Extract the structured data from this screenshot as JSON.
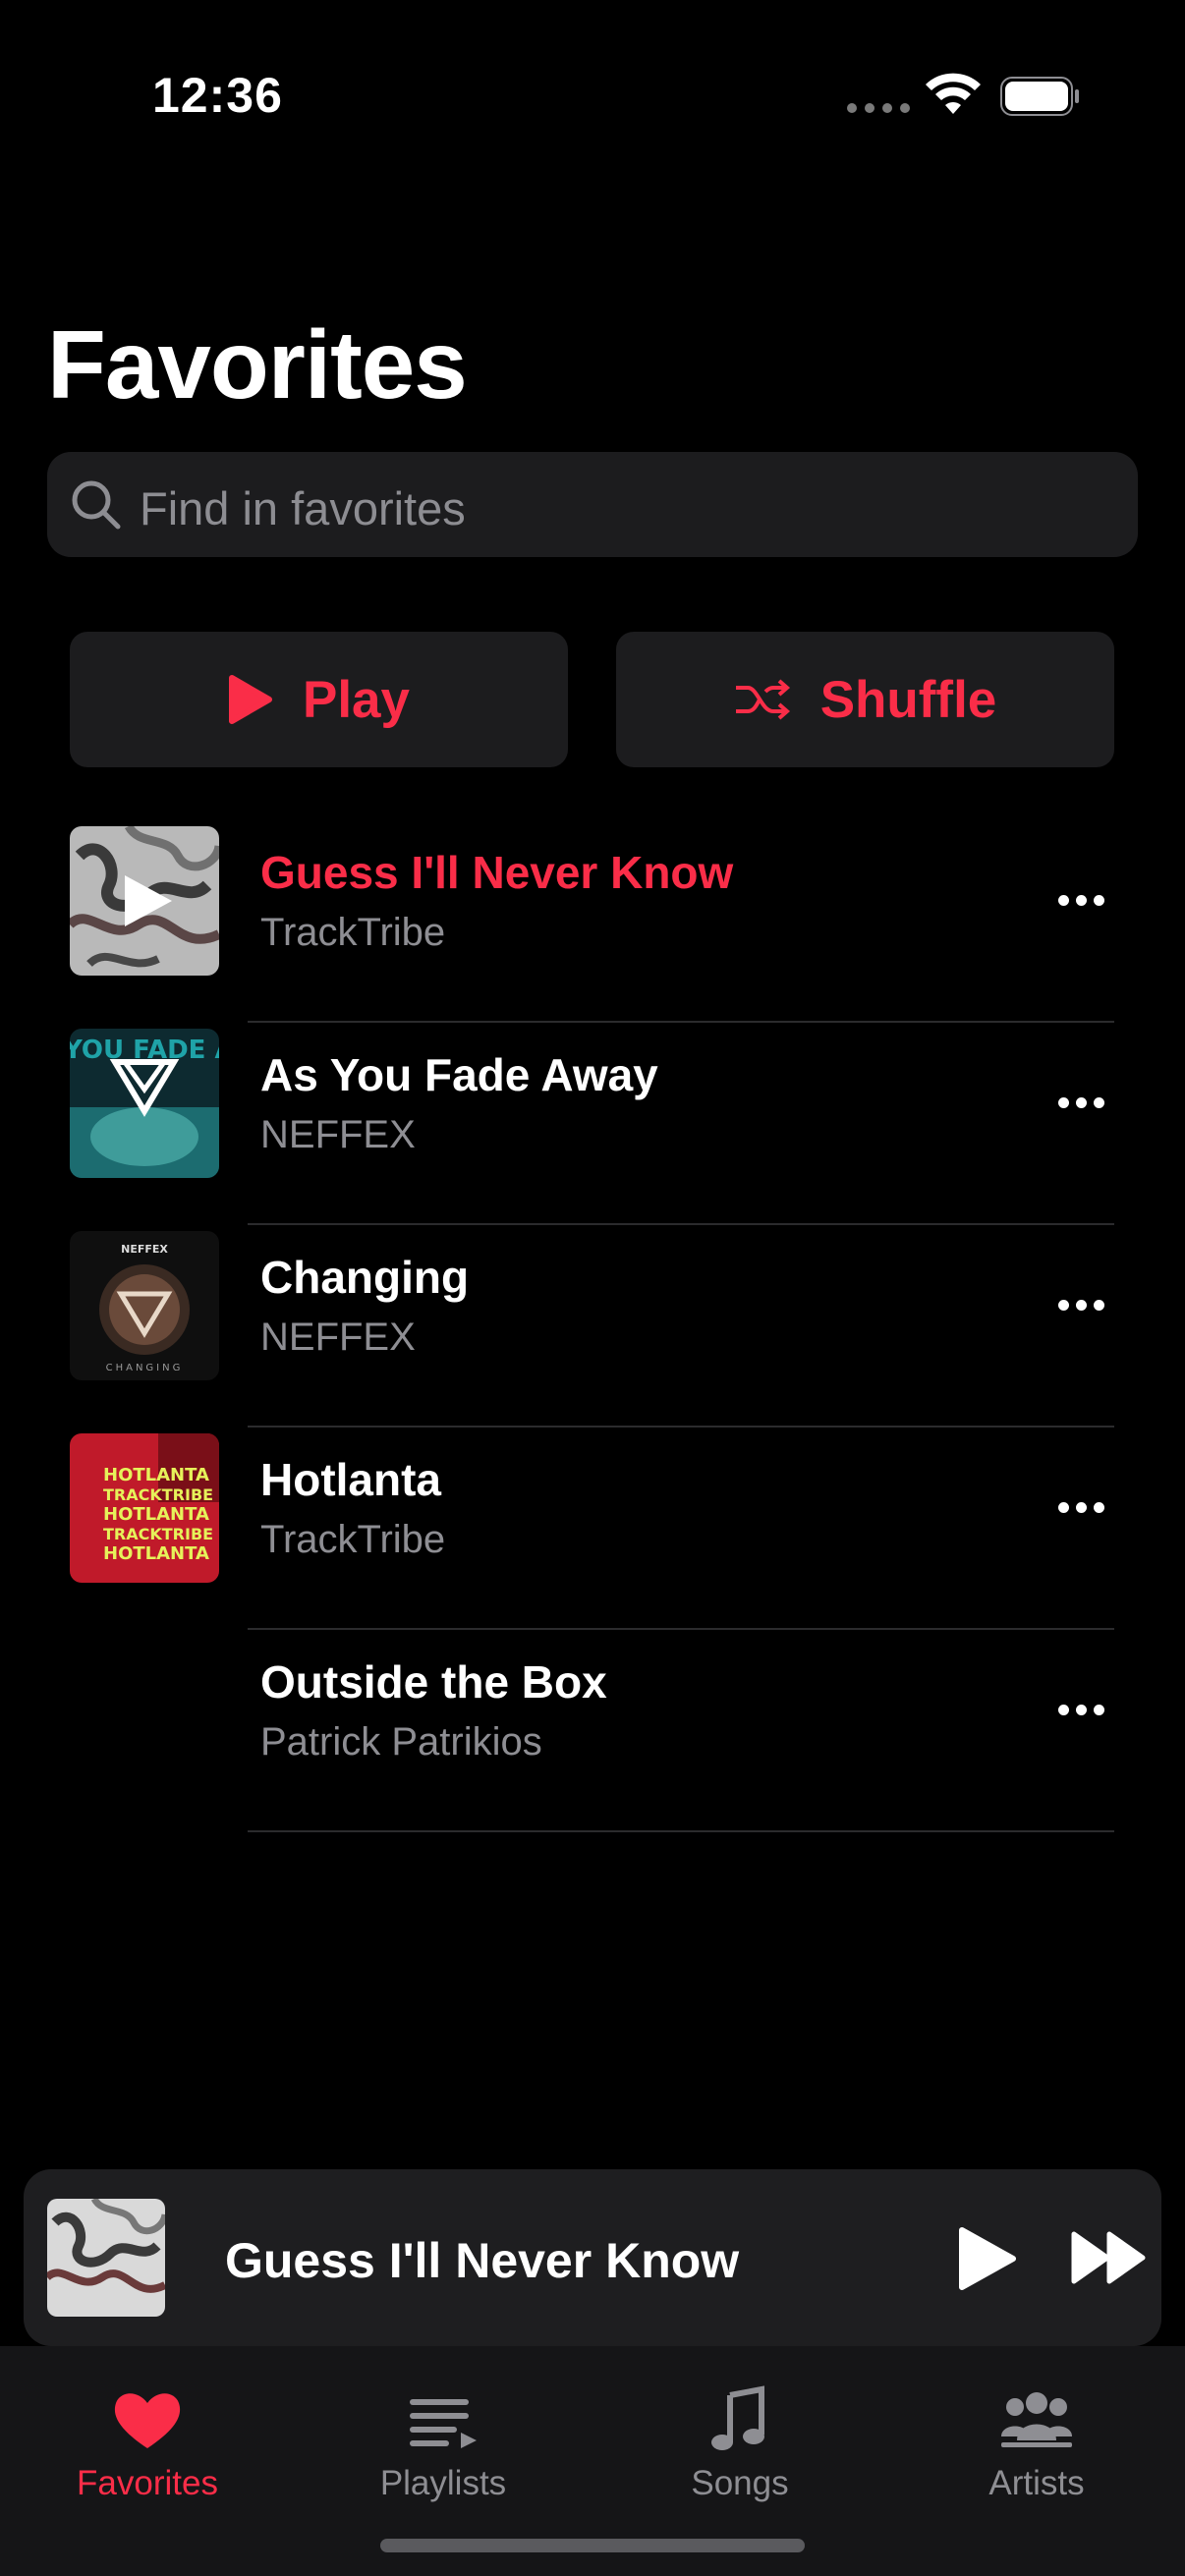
{
  "status": {
    "time": "12:36"
  },
  "page": {
    "title": "Favorites"
  },
  "search": {
    "placeholder": "Find in favorites"
  },
  "actions": {
    "play_label": "Play",
    "shuffle_label": "Shuffle"
  },
  "songs": [
    {
      "title": "Guess I'll Never Know",
      "artist": "TrackTribe",
      "playing": true
    },
    {
      "title": "As You Fade Away",
      "artist": "NEFFEX"
    },
    {
      "title": "Changing",
      "artist": "NEFFEX"
    },
    {
      "title": "Hotlanta",
      "artist": "TrackTribe"
    },
    {
      "title": "Outside the Box",
      "artist": "Patrick Patrikios"
    }
  ],
  "mini_player": {
    "title": "Guess I'll Never Know"
  },
  "tabs": [
    {
      "label": "Favorites",
      "icon": "heart-icon",
      "active": true
    },
    {
      "label": "Playlists",
      "icon": "playlist-icon"
    },
    {
      "label": "Songs",
      "icon": "music-note-icon"
    },
    {
      "label": "Artists",
      "icon": "people-icon"
    }
  ],
  "colors": {
    "accent": "#fa2d48",
    "background": "#000000",
    "secondary_text": "#8e8e93"
  },
  "album_art": {
    "changing_cover_text": [
      "NEFFEX",
      "CHANGING"
    ],
    "hotlanta_cover_text": [
      "HOTLANTA",
      "TRACKTRIBE"
    ],
    "fade_away_cover_text": "YOU FADE AWAY"
  }
}
